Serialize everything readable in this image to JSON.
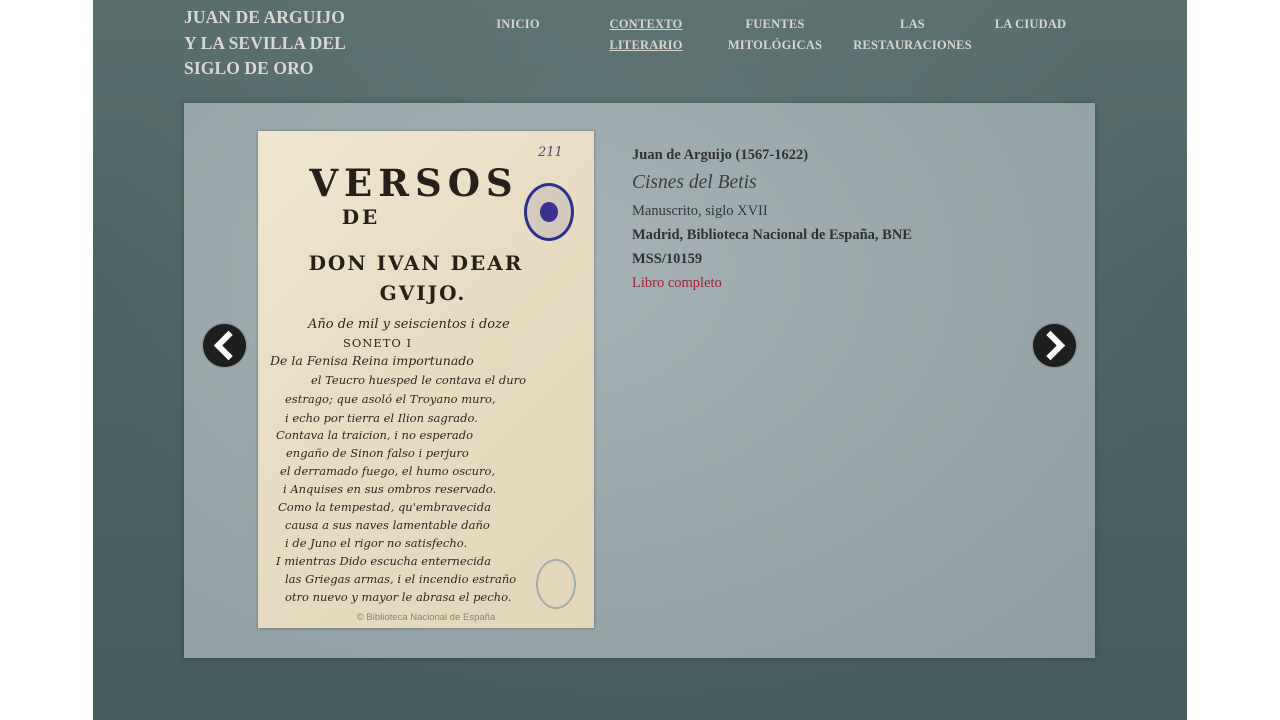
{
  "site": {
    "title_lines": [
      "JUAN DE ARGUIJO",
      "Y LA SEVILLA DEL",
      "SIGLO DE ORO"
    ]
  },
  "nav": {
    "items": [
      {
        "lines": [
          "INICIO"
        ],
        "active": false
      },
      {
        "lines": [
          "CONTEXTO",
          "LITERARIO"
        ],
        "active": true
      },
      {
        "lines": [
          "FUENTES",
          "MITOLÓGICAS"
        ],
        "active": false
      },
      {
        "lines": [
          "LAS",
          "RESTAURACIONES"
        ],
        "active": false
      },
      {
        "lines": [
          "LA CIUDAD"
        ],
        "active": false
      }
    ]
  },
  "slide": {
    "manuscript": {
      "title_lines": [
        "VERSOS",
        "DE",
        "DON IVAN DEAR",
        "GVIJO."
      ],
      "corner_mark": "211",
      "text_lines": [
        "Año de mil y seiscientos i doze",
        "SONETO I",
        "De la Fenisa Reina importunado",
        "el Teucro huesped le contava el duro",
        "estrago; que asoló el Troyano muro,",
        "i echo por tierra el Ilion sagrado.",
        "Contava la traicion, i no esperado",
        "engaño de Sinon falso i perjuro",
        "el derramado fuego, el humo oscuro,",
        "i Anquises en sus ombros reservado.",
        "Como la tempestad, qu'embravecida",
        "causa a sus naves lamentable daño",
        "i de Juno el rigor no satisfecho.",
        "I mientras Dido escucha enternecida",
        "las Griegas armas, i el incendio estraño",
        "otro nuevo y mayor le abrasa el pecho."
      ],
      "copyright": "© Biblioteca Nacional de España"
    },
    "info": {
      "author": "Juan de Arguijo (1567-1622)",
      "work": "Cisnes del Betis",
      "type": "Manuscrito, siglo XVII",
      "location": "Madrid, Biblioteca Nacional de España, BNE",
      "shelfmark": "MSS/10159",
      "link": "Libro completo"
    }
  },
  "colors": {
    "background": "#4e6464",
    "slider_panel": "#9aa8ab",
    "link": "#a4233b",
    "arrow": "#1e1e1e"
  },
  "icons": {
    "prev": "chevron-left-icon",
    "next": "chevron-right-icon"
  }
}
